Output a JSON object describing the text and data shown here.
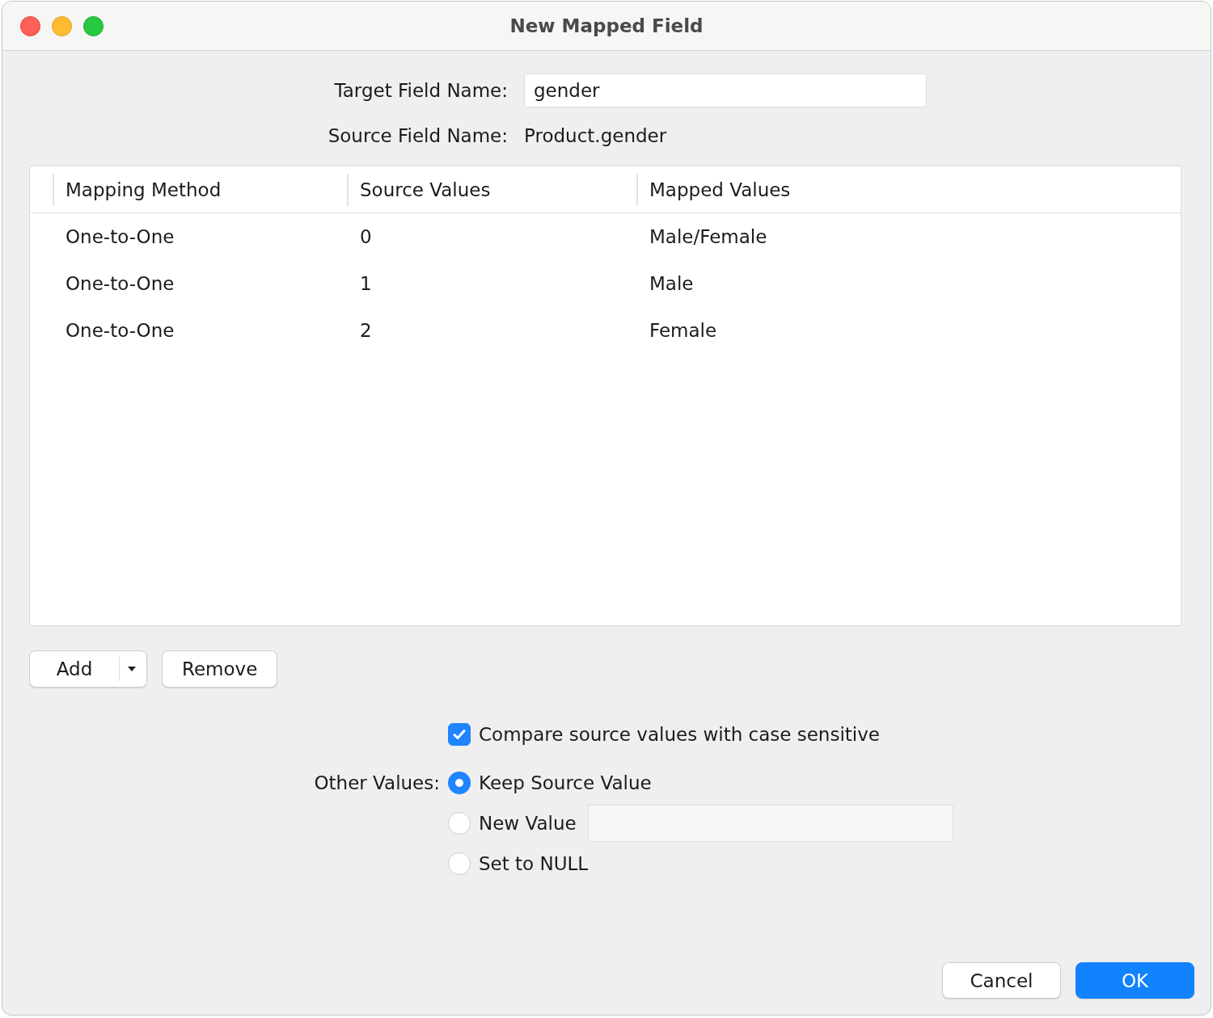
{
  "window": {
    "title": "New Mapped Field"
  },
  "target_field": {
    "label": "Target Field Name:",
    "value": "gender"
  },
  "source_field": {
    "label": "Source Field Name:",
    "value": "Product.gender"
  },
  "table": {
    "columns": [
      "Mapping Method",
      "Source Values",
      "Mapped Values"
    ],
    "rows": [
      {
        "cells": [
          "One-to-One",
          "0",
          "Male/Female"
        ]
      },
      {
        "cells": [
          "One-to-One",
          "1",
          "Male"
        ]
      },
      {
        "cells": [
          "One-to-One",
          "2",
          "Female"
        ]
      }
    ]
  },
  "table_buttons": [
    {
      "label": "Add",
      "kind": "split"
    },
    {
      "label": "Remove",
      "kind": "plain"
    }
  ],
  "case_sensitive": {
    "label": "Compare source values with case sensitive",
    "checked": true
  },
  "other_values": {
    "label": "Other Values:",
    "options": [
      {
        "label": "Keep Source Value",
        "selected": true,
        "kind": "plain"
      },
      {
        "label": "New Value",
        "selected": false,
        "kind": "with_field"
      },
      {
        "label": "Set to NULL",
        "selected": false,
        "kind": "plain"
      }
    ]
  },
  "dialog_buttons": [
    {
      "label": "Cancel",
      "kind": "secondary"
    },
    {
      "label": "OK",
      "kind": "primary"
    }
  ]
}
